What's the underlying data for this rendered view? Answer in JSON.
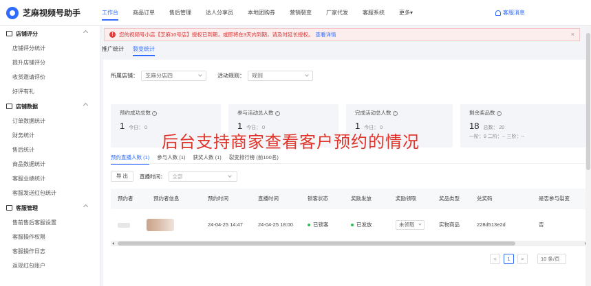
{
  "app": {
    "title": "芝麻视频号助手"
  },
  "topnav": {
    "items": [
      "工作台",
      "商品订单",
      "售后管理",
      "达人分享员",
      "本地团购券",
      "营销裂变",
      "厂家代发",
      "客服系统",
      "更多"
    ],
    "more_caret": "▾",
    "message": "客服消息"
  },
  "sidebar": {
    "sections": [
      {
        "title": "店铺评分",
        "items": [
          "店铺评分统计",
          "提升店铺评分",
          "收货邀请评价",
          "好评有礼"
        ]
      },
      {
        "title": "店铺数据",
        "items": [
          "订单数据统计",
          "财务统计",
          "售后统计",
          "商品数据统计",
          "客服业绩统计",
          "客服发送红包统计"
        ]
      },
      {
        "title": "客服管理",
        "items": [
          "售前售后客服设置",
          "客服操作权限",
          "客服操作日志",
          "返现红包账户"
        ]
      }
    ]
  },
  "alert": {
    "text": "您的视频号小店【芝麻10号店】授权已到期，或即将在3天内到期，请及时延长授权。",
    "link": "查看详情",
    "close": "×"
  },
  "subtabs": [
    "推广统计",
    "裂变统计"
  ],
  "filters": {
    "shop_label": "所属店铺：",
    "shop_value": "芝麻分店四",
    "rule_label": "活动规则：",
    "rule_value": "规则"
  },
  "stats": [
    {
      "title": "预约成功总数",
      "value": "1",
      "sub": "今日：  0"
    },
    {
      "title": "参与活动总人数",
      "value": "1",
      "sub": "今日：  0"
    },
    {
      "title": "完成活动总人数",
      "value": "1",
      "sub": "今日：  0"
    },
    {
      "title": "剩余奖品数",
      "value": "18",
      "sub": "总数：  20",
      "sub2": "一阶：9    二阶：--    三阶：--"
    }
  ],
  "overlay_caption": "后台支持商家查看客户预约的情况",
  "tabs": [
    "预约直播人数 (1)",
    "参与人数 (1)",
    "获奖人数 (1)",
    "裂变排行榜 (前100名)"
  ],
  "toolbar": {
    "export": "导 出",
    "time_label": "直播时间：",
    "time_placeholder": "全部"
  },
  "table": {
    "headers": [
      "预约者",
      "预约者信息",
      "预约时间",
      "直播时间",
      "锁客状态",
      "奖励发放",
      "奖励领取",
      "奖品类型",
      "兑奖码",
      "是否参与裂变"
    ],
    "row": {
      "reserve_time": "24-04-25 14:47",
      "live_time": "24-04-25 18:00",
      "lock_status": "已锁客",
      "reward_status": "已发放",
      "claim_status": "未领取",
      "prize_type": "实物商品",
      "code": "228d513e2d",
      "fission": "否"
    }
  },
  "pager": {
    "prev": "<",
    "current": "1",
    "next": ">",
    "size": "10 条/页"
  },
  "colors": {
    "accent": "#2f6bff",
    "overlay": "#e0352b",
    "success": "#2dbb55",
    "alert_bg": "#fdeeee"
  }
}
